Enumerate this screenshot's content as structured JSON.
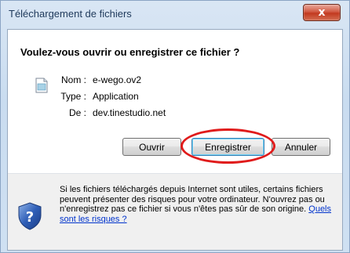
{
  "window": {
    "title": "Téléchargement de fichiers",
    "close_glyph": "x"
  },
  "dialog": {
    "heading": "Voulez-vous ouvrir ou enregistrer ce fichier ?",
    "file": {
      "icon": "generic-file-icon",
      "rows": [
        {
          "label": "Nom :",
          "value": "e-wego.ov2"
        },
        {
          "label": "Type :",
          "value": "Application"
        },
        {
          "label": "De :",
          "value": "dev.tinestudio.net"
        }
      ]
    },
    "buttons": {
      "open": "Ouvrir",
      "save": "Enregistrer",
      "cancel": "Annuler"
    },
    "annotation": {
      "shape": "red-ellipse-around-save-button",
      "color": "#e01b1b"
    },
    "warning": {
      "icon": "shield-question-icon",
      "text": "Si les fichiers téléchargés depuis Internet sont utiles, certains fichiers peuvent présenter des risques pour votre ordinateur. N'ouvrez pas ou n'enregistrez pas ce fichier si vous n'êtes pas sûr de son origine.",
      "link": "Quels sont les risques ?"
    }
  }
}
